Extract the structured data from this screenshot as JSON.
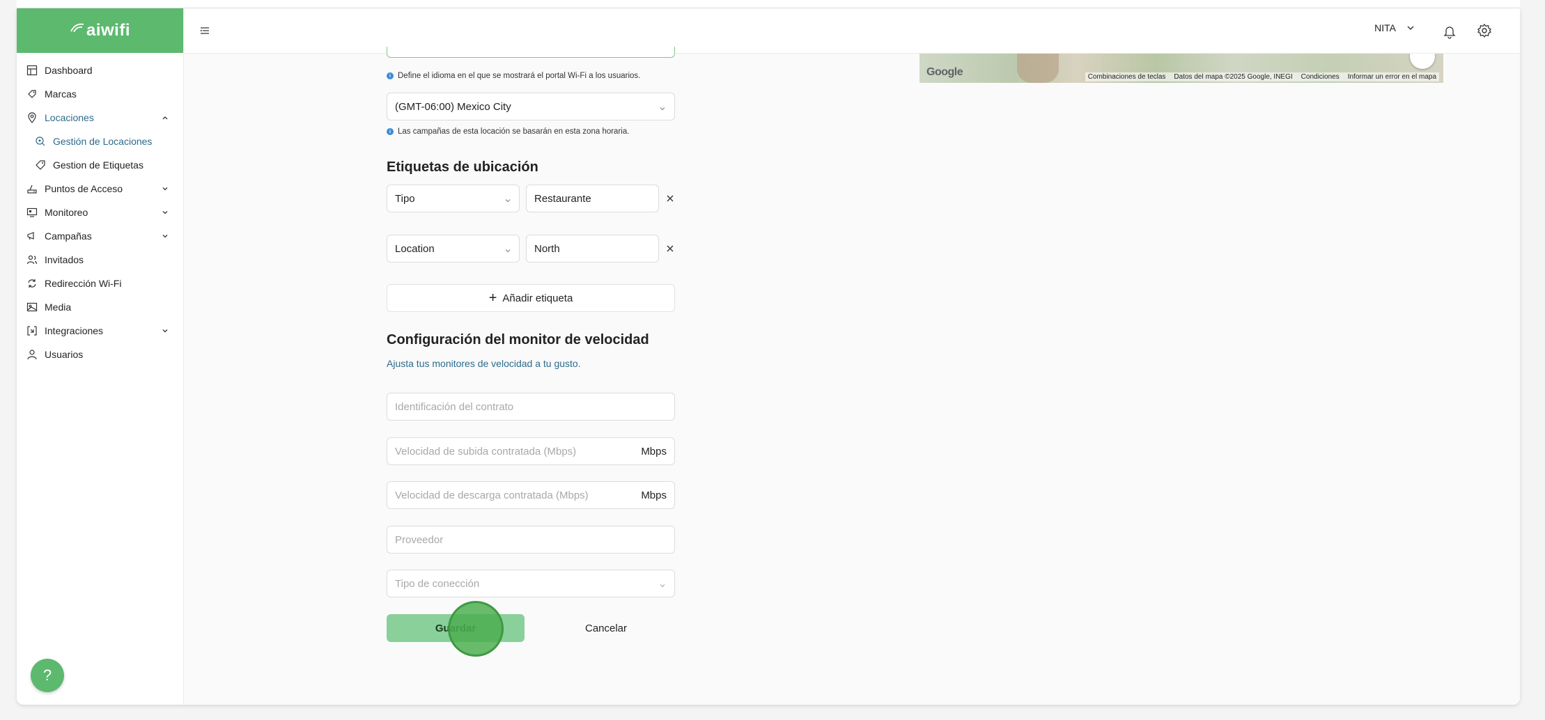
{
  "app": {
    "logo_text": "aiwifi"
  },
  "header": {
    "user_name": "NITA"
  },
  "sidebar": {
    "items": [
      {
        "label": "Dashboard"
      },
      {
        "label": "Marcas"
      },
      {
        "label": "Locaciones"
      },
      {
        "label": "Gestión de Locaciones"
      },
      {
        "label": "Gestion de Etiquetas"
      },
      {
        "label": "Puntos de Acceso"
      },
      {
        "label": "Monitoreo"
      },
      {
        "label": "Campañas"
      },
      {
        "label": "Invitados"
      },
      {
        "label": "Redirección Wi-Fi"
      },
      {
        "label": "Media"
      },
      {
        "label": "Integraciones"
      },
      {
        "label": "Usuarios"
      }
    ],
    "help_label": "?"
  },
  "form": {
    "language_hint": "Define el idioma en el que se mostrará el portal Wi-Fi a los usuarios.",
    "timezone_value": "(GMT-06:00) Mexico City",
    "timezone_hint": "Las campañas de esta locación se basarán en esta zona horaria.",
    "tags_title": "Etiquetas de ubicación",
    "tags": [
      {
        "key": "Tipo",
        "value": "Restaurante"
      },
      {
        "key": "Location",
        "value": "North"
      }
    ],
    "add_tag_label": "Añadir etiqueta",
    "speed_title": "Configuración del monitor de velocidad",
    "speed_subtitle": "Ajusta tus monitores de velocidad a tu gusto.",
    "contract_placeholder": "Identificación del contrato",
    "upload_placeholder": "Velocidad de subida contratada (Mbps)",
    "download_placeholder": "Velocidad de descarga contratada (Mbps)",
    "unit": "Mbps",
    "provider_placeholder": "Proveedor",
    "connection_placeholder": "Tipo de conección",
    "save_label": "Guardar",
    "cancel_label": "Cancelar"
  },
  "map": {
    "logo": "Google",
    "attribution": [
      "Combinaciones de teclas",
      "Datos del mapa ©2025 Google, INEGI",
      "Condiciones",
      "Informar un error en el mapa"
    ]
  },
  "colors": {
    "brand_green": "#5cb96e",
    "save_button": "#89d09a",
    "active_nav": "#2d6a8a",
    "info_dot": "#3b8ad9"
  }
}
